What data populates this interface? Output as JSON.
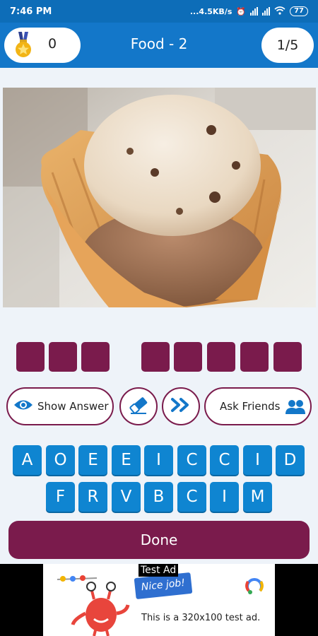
{
  "status_bar": {
    "time": "7:46 PM",
    "speed": "...4.5KB/s",
    "battery": "77"
  },
  "header": {
    "score": "0",
    "title": "Food - 2",
    "progress": "1/5"
  },
  "answer": {
    "word_lengths": [
      3,
      5
    ]
  },
  "actions": {
    "show_answer_label": "Show Answer",
    "ask_friends_label": "Ask Friends"
  },
  "keyboard": {
    "row1": [
      "A",
      "O",
      "E",
      "E",
      "I",
      "C",
      "C",
      "I",
      "D"
    ],
    "row2": [
      "F",
      "R",
      "V",
      "B",
      "C",
      "I",
      "M"
    ]
  },
  "done_label": "Done",
  "ad": {
    "label": "Test Ad",
    "banner": "Nice job!",
    "text": "This is a 320x100 test ad."
  },
  "colors": {
    "header_blue": "#1377c9",
    "accent_maroon": "#7a1b4c",
    "key_blue": "#0f85d1"
  }
}
